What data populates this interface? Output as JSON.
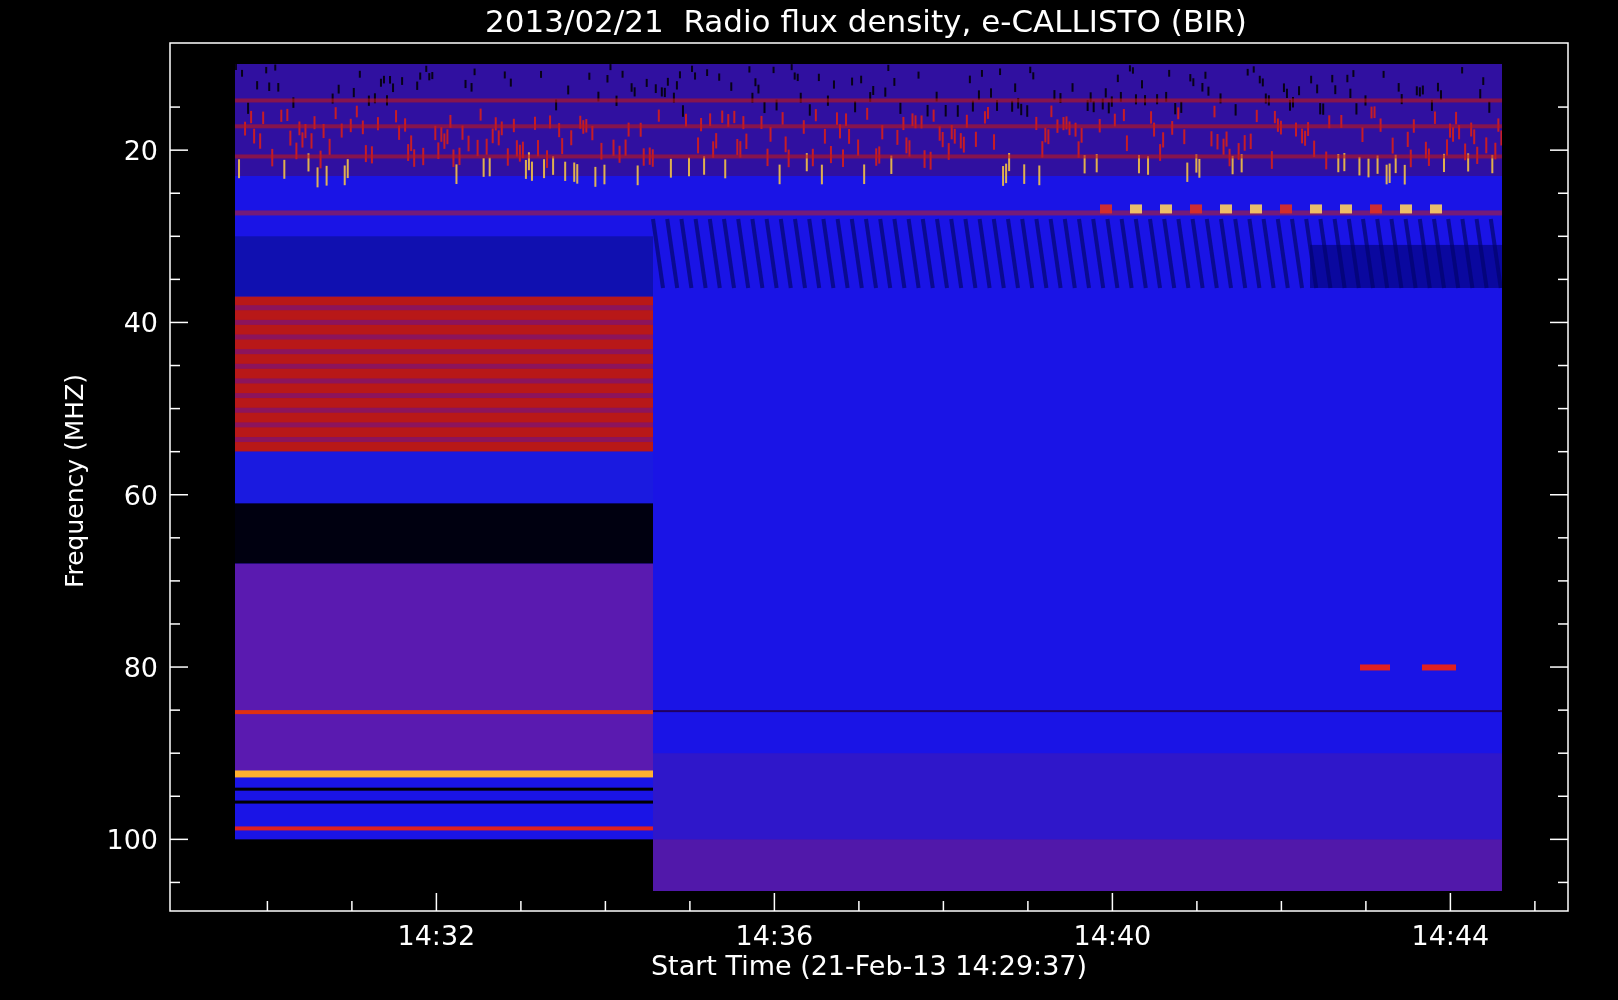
{
  "title": "2013/02/21  Radio flux density, e-CALLISTO (BIR)",
  "y_axis": {
    "label": "Frequency (MHZ)",
    "ticks": [
      "20",
      "40",
      "60",
      "80",
      "100"
    ]
  },
  "x_axis": {
    "label": "Start Time (21-Feb-13 14:29:37)",
    "ticks": [
      "14:32",
      "14:36",
      "14:40",
      "14:44"
    ]
  }
}
